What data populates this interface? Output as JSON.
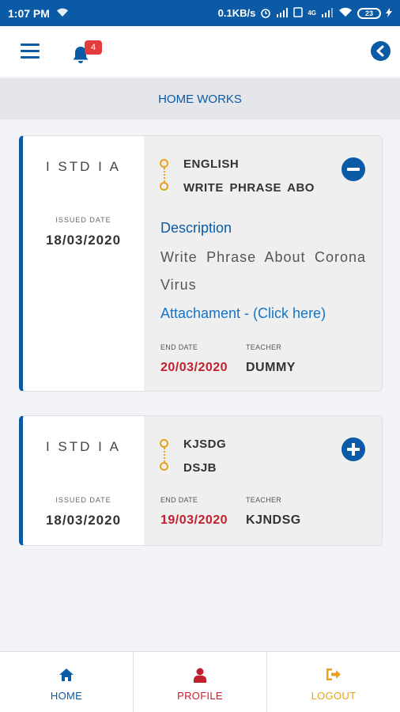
{
  "status_bar": {
    "time": "1:07 PM",
    "net_speed": "0.1KB/s",
    "network_label": "4G",
    "battery": "23"
  },
  "header": {
    "notification_count": "4"
  },
  "section_title": "HOME WORKS",
  "labels": {
    "issued_date": "ISSUED DATE",
    "end_date": "END DATE",
    "teacher": "TEACHER",
    "description": "Description"
  },
  "homeworks": [
    {
      "class_name": "I STD I A",
      "issued_date": "18/03/2020",
      "subject": "ENGLISH",
      "topic": "WRITE PHRASE ABO",
      "expanded": true,
      "description": "Write Phrase About Corona Virus",
      "attachment_label": "Attachament - (Click here)",
      "end_date": "20/03/2020",
      "teacher": "DUMMY"
    },
    {
      "class_name": "I STD I A",
      "issued_date": "18/03/2020",
      "subject": "KJSDG",
      "topic": "DSJB",
      "expanded": false,
      "end_date": "19/03/2020",
      "teacher": "KJNDSG"
    }
  ],
  "bottom_nav": [
    {
      "label": "HOME",
      "icon": "home-icon",
      "color": "#0b5aa6"
    },
    {
      "label": "PROFILE",
      "icon": "user-icon",
      "color": "#c2202e"
    },
    {
      "label": "LOGOUT",
      "icon": "logout-icon",
      "color": "#e8a21a"
    }
  ],
  "colors": {
    "primary": "#0b5aa6",
    "accent_red": "#c2202e",
    "accent_orange": "#e8a21a"
  }
}
